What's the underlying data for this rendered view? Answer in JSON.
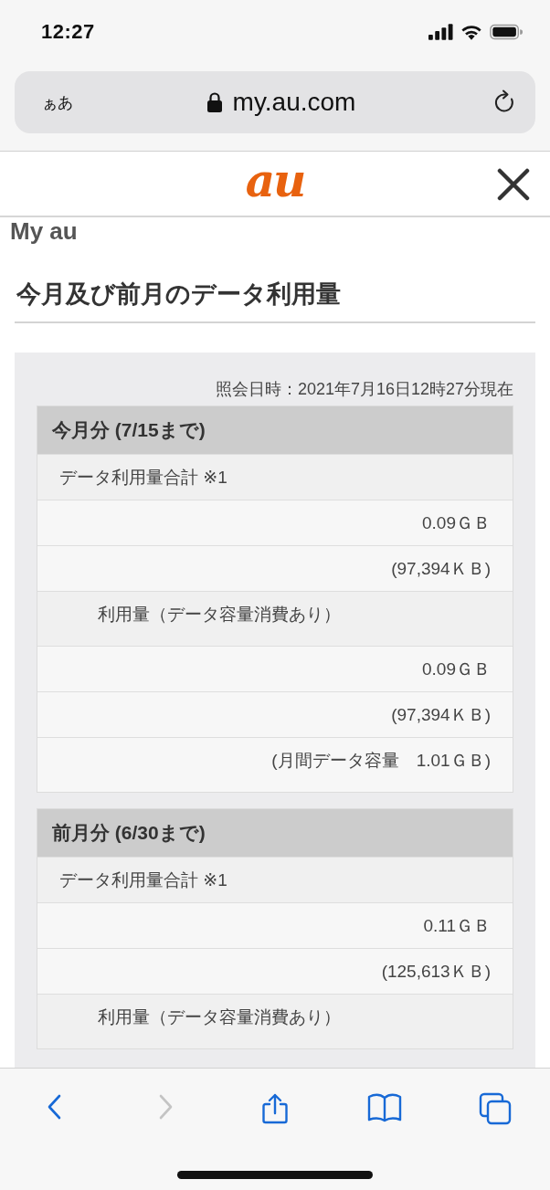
{
  "status_bar": {
    "time": "12:27"
  },
  "address_bar": {
    "text_size_button": "ぁあ",
    "url": "my.au.com"
  },
  "site_header": {
    "logo": "au"
  },
  "brand": "My au",
  "page_title": "今月及び前月のデータ利用量",
  "inquiry_time": "照会日時：2021年7月16日12時27分現在",
  "sections": [
    {
      "title": "今月分 (7/15まで)",
      "rows": [
        {
          "kind": "label",
          "text": "データ利用量合計 ※1"
        },
        {
          "kind": "value",
          "text": "0.09ＧＢ"
        },
        {
          "kind": "value",
          "text": "(97,394ＫＢ)"
        },
        {
          "kind": "sublabel",
          "text": "利用量（データ容量消費あり）"
        },
        {
          "kind": "value",
          "text": "0.09ＧＢ"
        },
        {
          "kind": "value",
          "text": "(97,394ＫＢ)"
        },
        {
          "kind": "value",
          "text": "(月間データ容量　1.01ＧＢ)"
        }
      ]
    },
    {
      "title": "前月分 (6/30まで)",
      "rows": [
        {
          "kind": "label",
          "text": "データ利用量合計 ※1"
        },
        {
          "kind": "value",
          "text": "0.11ＧＢ"
        },
        {
          "kind": "value",
          "text": "(125,613ＫＢ)"
        },
        {
          "kind": "sublabel",
          "text": "利用量（データ容量消費あり）"
        }
      ]
    }
  ],
  "toolbar": [
    {
      "kind": "back",
      "disabled": false
    },
    {
      "kind": "forward",
      "disabled": true
    },
    {
      "kind": "share",
      "disabled": false
    },
    {
      "kind": "bookmarks",
      "disabled": false
    },
    {
      "kind": "tabs",
      "disabled": false
    }
  ]
}
